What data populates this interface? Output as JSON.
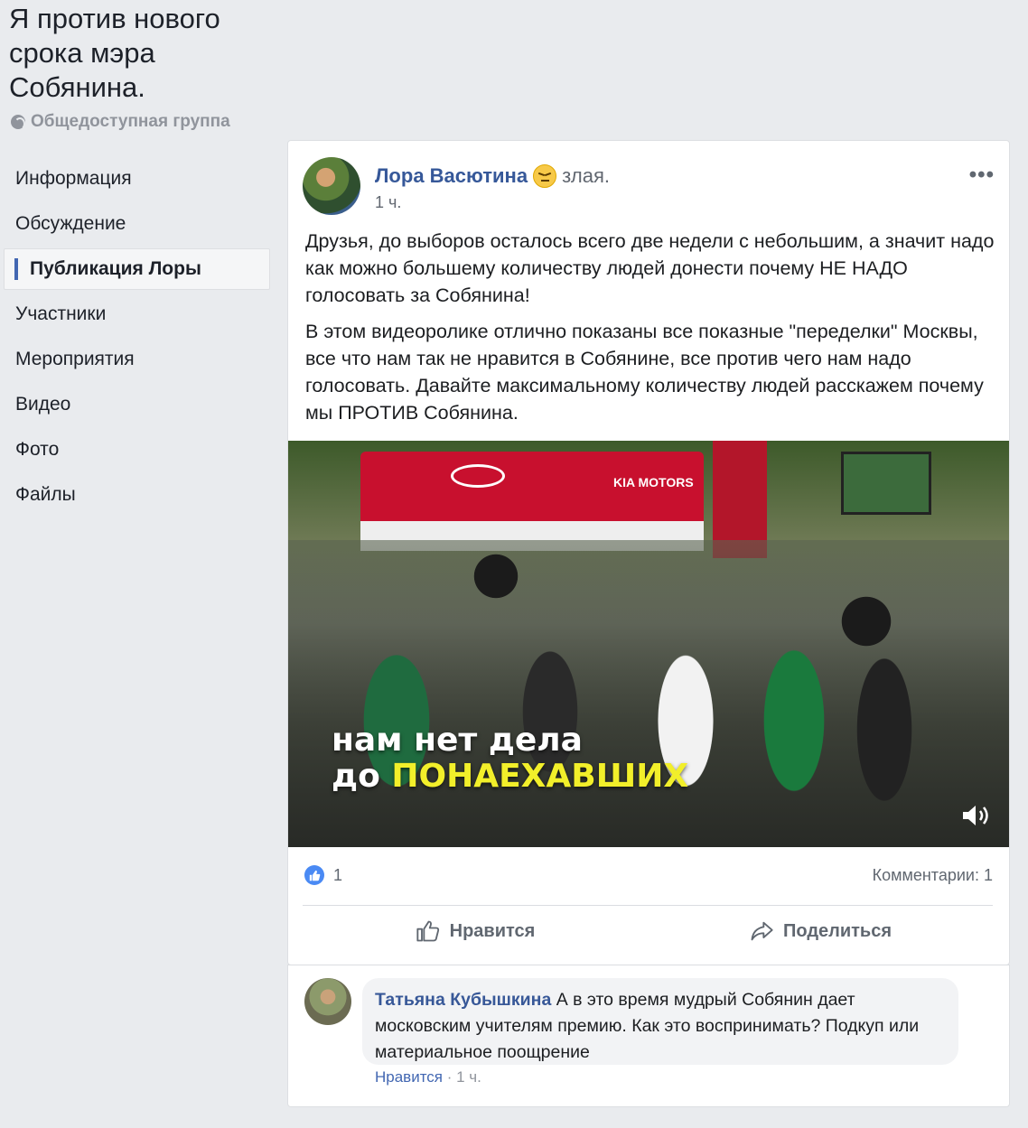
{
  "group": {
    "title": "Я против нового срока мэра Собянина.",
    "privacy": "Общедоступная группа"
  },
  "nav": [
    {
      "label": "Информация"
    },
    {
      "label": "Обсуждение"
    },
    {
      "label": "Публикация Лоры",
      "active": true
    },
    {
      "label": "Участники"
    },
    {
      "label": "Мероприятия"
    },
    {
      "label": "Видео"
    },
    {
      "label": "Фото"
    },
    {
      "label": "Файлы"
    }
  ],
  "post": {
    "author": "Лора Васютина",
    "feeling": "злая.",
    "time": "1 ч.",
    "more": "•••",
    "paragraph1": "Друзья, до выборов осталось всего две недели с небольшим, а значит надо как можно большему количеству людей донести почему НЕ НАДО голосовать за Собянина!",
    "paragraph2": "В этом видеоролике отлично показаны все показные \"переделки\" Москвы, все что нам так не нравится в Собянине, все против чего нам надо голосовать. Давайте максимальному количеству людей расскажем почему мы ПРОТИВ Собянина.",
    "video": {
      "sign_text": "KIA MOTORS",
      "caption_line1": "нам нет дела",
      "caption_line2_prefix": "до ",
      "caption_line2_highlight": "ПОНАЕХАВШИХ"
    },
    "likes": "1",
    "comments": "Комментарии: 1",
    "like_label": "Нравится",
    "share_label": "Поделиться"
  },
  "comment": {
    "author": "Татьяна Кубышкина",
    "text": "А в это время мудрый Собянин дает московским учителям премию. Как это воспринимать? Подкуп или материальное поощрение",
    "like_label": "Нравится",
    "separator": " · ",
    "time": "1 ч."
  },
  "colors": {
    "link": "#365899",
    "accent": "#4267b2",
    "caption_highlight": "#f2ef2a"
  }
}
